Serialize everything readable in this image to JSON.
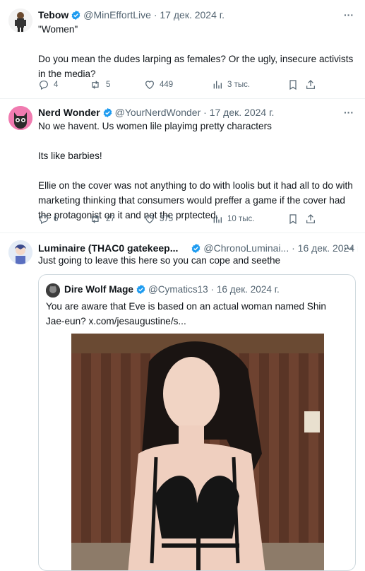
{
  "tweets": [
    {
      "name": "Tebow",
      "handle": "@MinEffortLive",
      "date": "· 17 дек. 2024 г.",
      "text": "\"Women\"\n\nDo you mean the dudes larping as females? Or the ugly, insecure activists in the media?",
      "replies": "4",
      "retweets": "5",
      "likes": "449",
      "views": "3 тыс."
    },
    {
      "name": "Nerd Wonder",
      "handle": "@YourNerdWonder",
      "date": "· 17 дек. 2024 г.",
      "text": "No we havent. Us women lile playimg pretty characters\n\nIts like barbies!\n\nEllie on the cover was not anything to do with loolis but it had all to do with marketing thinking that consumers would preffer a game if the cover had the protagonist on it and not the prptected.",
      "replies": "6",
      "retweets": "27",
      "likes": "375",
      "views": "10 тыс."
    },
    {
      "name": "Luminaire (THAC0 gatekeep...",
      "handle": "@ChronoLuminai...",
      "date": "· 16 дек. 2024 г.",
      "text": "Just going to leave this here so you can cope and seethe"
    }
  ],
  "quote": {
    "name": "Dire Wolf Mage",
    "handle": "@Cymatics13",
    "date": "· 16 дек. 2024 г.",
    "text": "You are aware that Eve is based on an actual woman named Shin Jae-eun? x.com/jesaugustine/s..."
  },
  "icons": {
    "more": "more-icon",
    "reply": "reply-icon",
    "retweet": "retweet-icon",
    "like": "heart-icon",
    "views": "views-icon",
    "bookmark": "bookmark-icon",
    "share": "share-icon",
    "verified": "verified-badge-icon"
  },
  "colors": {
    "verified": "#1d9bf0",
    "muted": "#536471",
    "border": "#cfd9de"
  }
}
